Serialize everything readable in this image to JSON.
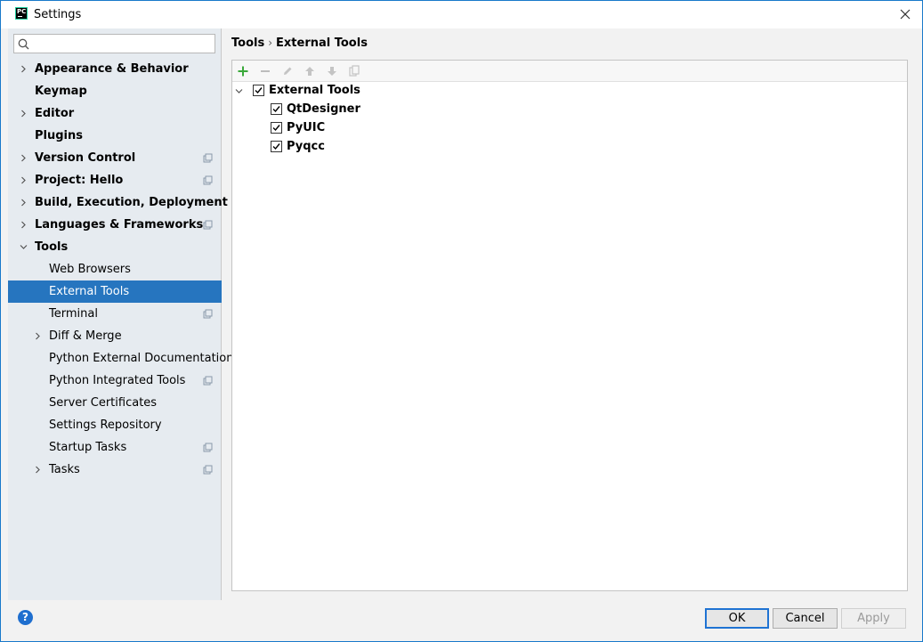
{
  "window": {
    "title": "Settings",
    "logo_text": "PC"
  },
  "search": {
    "value": "",
    "placeholder": ""
  },
  "sidebar": {
    "items": [
      {
        "label": "Appearance & Behavior",
        "bold": true,
        "arrow": "right",
        "indent": 0,
        "project_icon": false
      },
      {
        "label": "Keymap",
        "bold": true,
        "arrow": null,
        "indent": 0,
        "project_icon": false
      },
      {
        "label": "Editor",
        "bold": true,
        "arrow": "right",
        "indent": 0,
        "project_icon": false
      },
      {
        "label": "Plugins",
        "bold": true,
        "arrow": null,
        "indent": 0,
        "project_icon": false
      },
      {
        "label": "Version Control",
        "bold": true,
        "arrow": "right",
        "indent": 0,
        "project_icon": true
      },
      {
        "label": "Project: Hello",
        "bold": true,
        "arrow": "right",
        "indent": 0,
        "project_icon": true
      },
      {
        "label": "Build, Execution, Deployment",
        "bold": true,
        "arrow": "right",
        "indent": 0,
        "project_icon": false
      },
      {
        "label": "Languages & Frameworks",
        "bold": true,
        "arrow": "right",
        "indent": 0,
        "project_icon": true
      },
      {
        "label": "Tools",
        "bold": true,
        "arrow": "down",
        "indent": 0,
        "project_icon": false
      },
      {
        "label": "Web Browsers",
        "bold": false,
        "arrow": null,
        "indent": 1,
        "project_icon": false
      },
      {
        "label": "External Tools",
        "bold": false,
        "arrow": null,
        "indent": 1,
        "project_icon": false,
        "selected": true
      },
      {
        "label": "Terminal",
        "bold": false,
        "arrow": null,
        "indent": 1,
        "project_icon": true
      },
      {
        "label": "Diff & Merge",
        "bold": false,
        "arrow": "right",
        "indent": 1,
        "project_icon": false
      },
      {
        "label": "Python External Documentation",
        "bold": false,
        "arrow": null,
        "indent": 1,
        "project_icon": false
      },
      {
        "label": "Python Integrated Tools",
        "bold": false,
        "arrow": null,
        "indent": 1,
        "project_icon": true
      },
      {
        "label": "Server Certificates",
        "bold": false,
        "arrow": null,
        "indent": 1,
        "project_icon": false
      },
      {
        "label": "Settings Repository",
        "bold": false,
        "arrow": null,
        "indent": 1,
        "project_icon": false
      },
      {
        "label": "Startup Tasks",
        "bold": false,
        "arrow": null,
        "indent": 1,
        "project_icon": true
      },
      {
        "label": "Tasks",
        "bold": false,
        "arrow": "right",
        "indent": 1,
        "project_icon": true
      }
    ]
  },
  "breadcrumb": {
    "parent": "Tools",
    "separator": "›",
    "current": "External Tools"
  },
  "toolbar": {
    "buttons": [
      {
        "name": "add",
        "icon": "plus-icon",
        "enabled": true
      },
      {
        "name": "remove",
        "icon": "minus-icon",
        "enabled": false
      },
      {
        "name": "edit",
        "icon": "pencil-icon",
        "enabled": false
      },
      {
        "name": "move-up",
        "icon": "arrow-up-icon",
        "enabled": false
      },
      {
        "name": "move-down",
        "icon": "arrow-down-icon",
        "enabled": false
      },
      {
        "name": "copy",
        "icon": "copy-icon",
        "enabled": false
      }
    ]
  },
  "tools_tree": {
    "group": {
      "label": "External Tools",
      "checked": true,
      "expanded": true
    },
    "tools": [
      {
        "label": "QtDesigner",
        "checked": true
      },
      {
        "label": "PyUIC",
        "checked": true
      },
      {
        "label": "Pyqcc",
        "checked": true
      }
    ]
  },
  "footer": {
    "help_label": "?",
    "ok_label": "OK",
    "cancel_label": "Cancel",
    "apply_label": "Apply"
  },
  "colors": {
    "accent": "#2675bf",
    "sidebar_bg": "#e6ebf0",
    "add_green": "#3aa83a"
  }
}
